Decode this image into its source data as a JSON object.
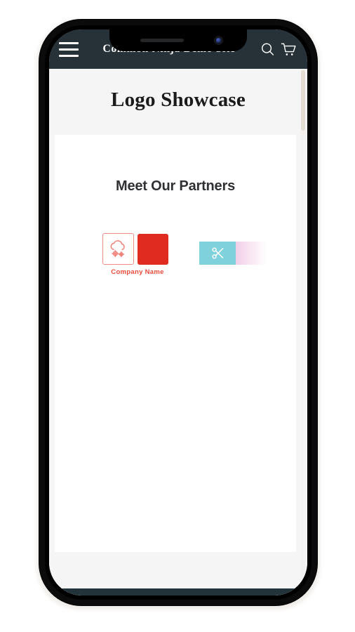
{
  "device": {
    "type": "smartphone-mockup",
    "notch": {
      "speaker_name": "earpiece-speaker",
      "camera_name": "front-camera"
    },
    "buttons": {
      "silent_switch": "silent-switch",
      "volume_up": "volume-up-button",
      "volume_down": "volume-down-button",
      "power": "power-button"
    }
  },
  "header": {
    "title": "Common Ninja Demo Site",
    "menu_icon": "hamburger-menu-icon",
    "search_icon": "search-icon",
    "cart_icon": "shopping-cart-icon",
    "background_color": "#263238",
    "text_color": "#ffffff"
  },
  "page": {
    "title": "Logo Showcase",
    "background_color": "#f5f5f5",
    "card_background": "#ffffff"
  },
  "section": {
    "heading": "Meet Our Partners"
  },
  "logos": [
    {
      "name": "cloud-gear-logo",
      "caption": "Company Name",
      "icon": "cloud-with-gears-icon",
      "accent_color": "#ee4b3c",
      "border_color": "#f08b85"
    },
    {
      "name": "red-square-logo",
      "caption": "",
      "icon": "solid-square",
      "accent_color": "#e02b20"
    },
    {
      "name": "scissors-logo",
      "caption": "",
      "icon": "scissors-icon",
      "accent_color": "#7fd2dc"
    },
    {
      "name": "pink-gradient-logo",
      "caption": "",
      "icon": "gradient-panel",
      "accent_color": "#f2cfe8"
    }
  ],
  "scrollbar": {
    "name": "vertical-scrollbar",
    "thumb_color": "#e3ddd4",
    "track_color": "#f3f2f1"
  }
}
